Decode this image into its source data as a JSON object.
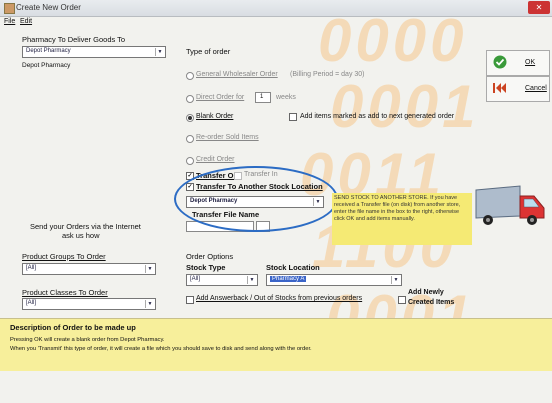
{
  "window": {
    "title": "Create New Order"
  },
  "menu": {
    "file": "File",
    "edit": "Edit"
  },
  "background_digits": [
    "0000",
    "0001",
    "0011",
    "1100",
    "0001"
  ],
  "left": {
    "pharmacy_label": "Pharmacy To Deliver Goods To",
    "pharmacy_value": "Depot Pharmacy",
    "pharmacy_name": "Depot Pharmacy",
    "internet_line1": "Send your Orders via the Internet",
    "internet_line2": "ask us how",
    "product_groups_label": "Product Groups To Order",
    "product_groups_value": "[All]",
    "product_classes_label": "Product Classes To Order",
    "product_classes_value": "[All]"
  },
  "order_type": {
    "label": "Type of order",
    "general": "General Wholesaler Order",
    "billing": "(Billing Period = day 30)",
    "direct_prefix": "Direct Order for",
    "direct_value": "1",
    "direct_suffix": "weeks",
    "blank": "Blank Order",
    "add_items": "Add items marked as add to next generated order",
    "reorder": "Re-order Sold Items",
    "credit": "Credit Order",
    "transfer_out": "Transfer Out",
    "transfer_in": "Transfer In",
    "transfer_another": "Transfer To Another Stock Location",
    "transfer_dest": "Depot Pharmacy",
    "transfer_file_label": "Transfer File Name"
  },
  "send_stock_note": "SEND STOCK TO ANOTHER STORE. If you have received a Transfer file (on disk) from another store, enter the file name in the box to the right, otherwise click OK and add items manually.",
  "order_options": {
    "label": "Order Options",
    "stock_type_label": "Stock Type",
    "stock_type_value": "[All]",
    "stock_location_label": "Stock Location",
    "stock_location_value": "Pharmacy A",
    "add_answerback": "Add Answerback / Out of Stocks from previous orders",
    "add_newly_line1": "Add Newly",
    "add_newly_line2": "Created Items"
  },
  "buttons": {
    "ok": "OK",
    "cancel": "Cancel"
  },
  "description": {
    "header": "Description of Order to be made up",
    "line1": "Pressing OK will create a blank order from Depot Pharmacy.",
    "line2": "When you 'Transmit' this type of order, it will create a file which you should save to disk and send along with the order."
  },
  "colors": {
    "accent_ring": "#2c6cc4",
    "yellow": "#f5ea74",
    "digits": "#f6c88c"
  }
}
